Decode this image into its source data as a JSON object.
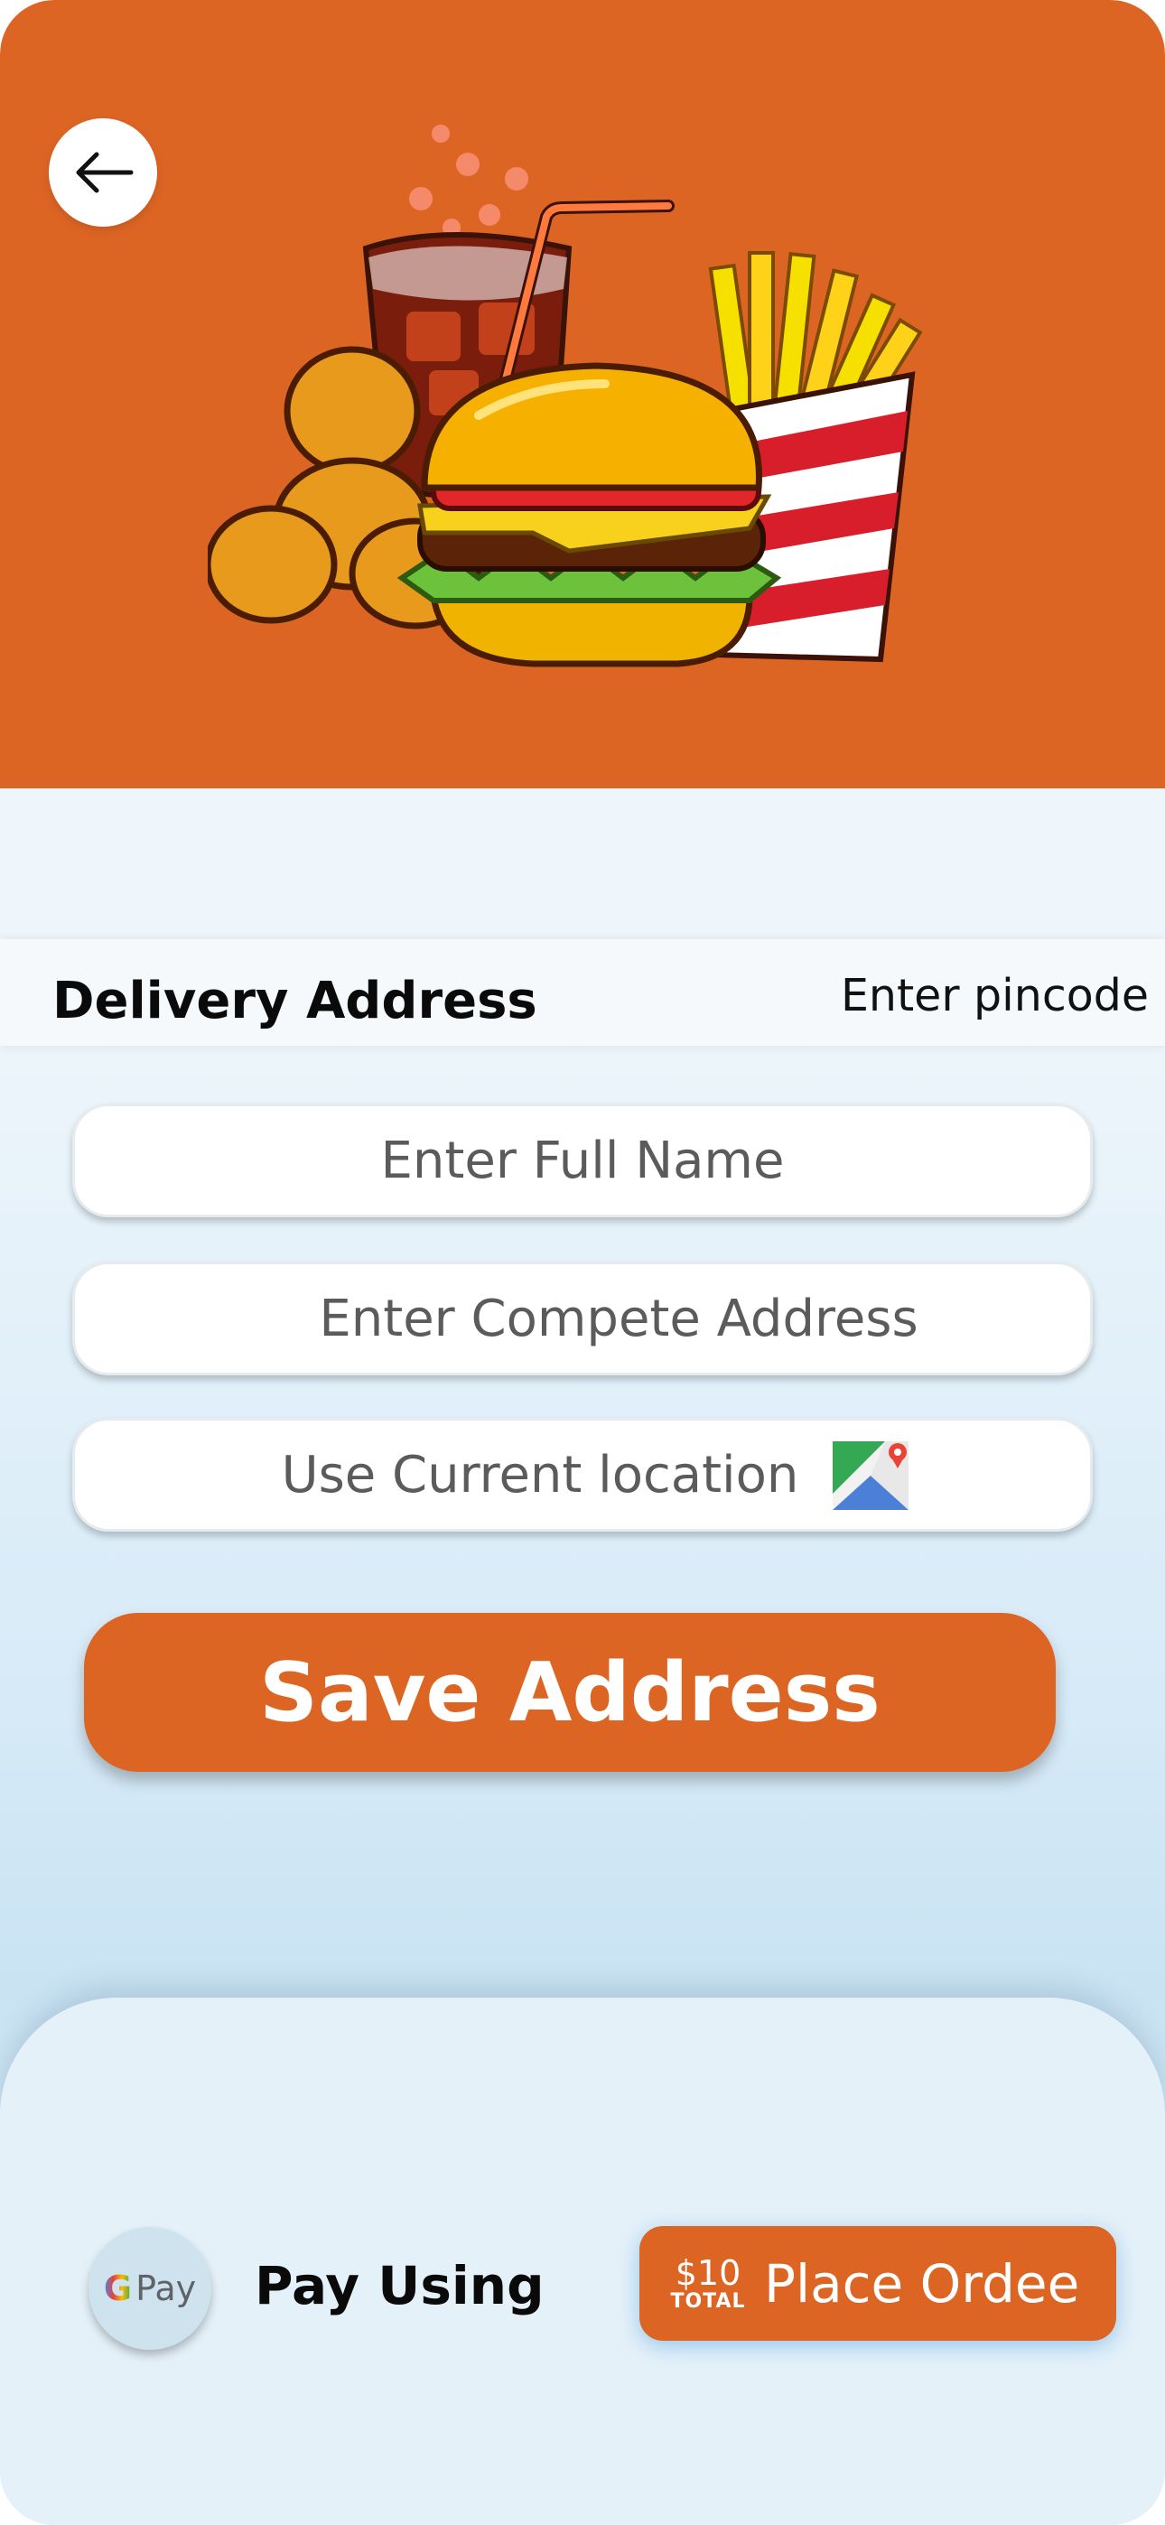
{
  "colors": {
    "accent": "#dd6524",
    "background": "#eef6fb",
    "sheet": "#e5f1f9",
    "text": "#0a0a0a",
    "placeholder": "#5b5b5b"
  },
  "header": {
    "back_icon": "arrow-left-icon",
    "hero_image": "burger-fries-drink-combo-illustration"
  },
  "address": {
    "title": "Delivery Address",
    "pincode_label": "Enter pincode",
    "full_name_placeholder": "Enter Full Name",
    "address_placeholder": "Enter Compete Address",
    "location_label": "Use Current location",
    "location_icon": "google-maps-icon",
    "save_label": "Save Address"
  },
  "footer": {
    "payment_icon": "google-pay-icon",
    "gpay_g": "G",
    "gpay_pay": "Pay",
    "pay_using_label": "Pay Using",
    "total_amount": "$10",
    "total_label": "TOTAL",
    "place_order_label": "Place Ordee"
  }
}
